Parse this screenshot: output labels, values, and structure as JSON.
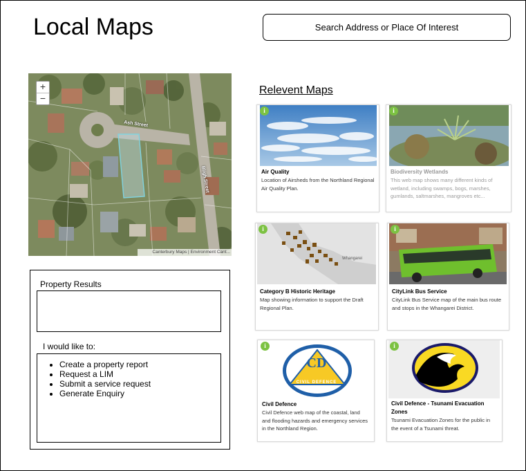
{
  "page": {
    "title": "Local Maps"
  },
  "search": {
    "placeholder": "Search Address or Place Of Interest"
  },
  "map": {
    "zoom_in": "+",
    "zoom_out": "−",
    "attribution": "Canterbury Maps | Environment Cant...",
    "street_labels": [
      "Ash Street",
      "Bligh Street"
    ]
  },
  "property_panel": {
    "results_label": "Property Results",
    "actions_label": "I would like to:",
    "actions": [
      "Create a property report",
      "Request a LIM",
      "Submit a service request",
      "Generate Enquiry"
    ]
  },
  "relevant_maps": {
    "heading": "Relevent Maps",
    "info_glyph": "i",
    "cards": [
      {
        "title": "Air Quality",
        "description": "Location of Airsheds from the Northland Regional Air Quality Plan.",
        "image": "sky-clouds"
      },
      {
        "title": "Biodiversity Wetlands",
        "description": "This web map shows many different kinds of wetland, including swamps, bogs, marshes, gumlands, saltmarshes, mangroves etc...",
        "image": "wetland"
      },
      {
        "title": "Category B Historic Heritage",
        "description": "Map showing information to support the Draft Regional Plan.",
        "image": "heritage-map",
        "map_label": "Whangarei"
      },
      {
        "title": "CityLink Bus Service",
        "description": "CityLink Bus Service map of the main bus route and stops in the Whangarei District.",
        "image": "bus"
      },
      {
        "title": "Civil Defence",
        "description": "Civil Defence web map of the coastal, land and flooding hazards and emergency services in the Northland Region.",
        "image": "civil-defence-logo",
        "logo_text_top": "CD",
        "logo_text_bottom": "CIVIL DEFENCE"
      },
      {
        "title": "Civil Defence - Tsunami Evacuation Zones",
        "description": "Tsunami Evacuation Zones for the public in the event of a Tsunami threat.",
        "image": "tsunami-logo"
      }
    ]
  }
}
